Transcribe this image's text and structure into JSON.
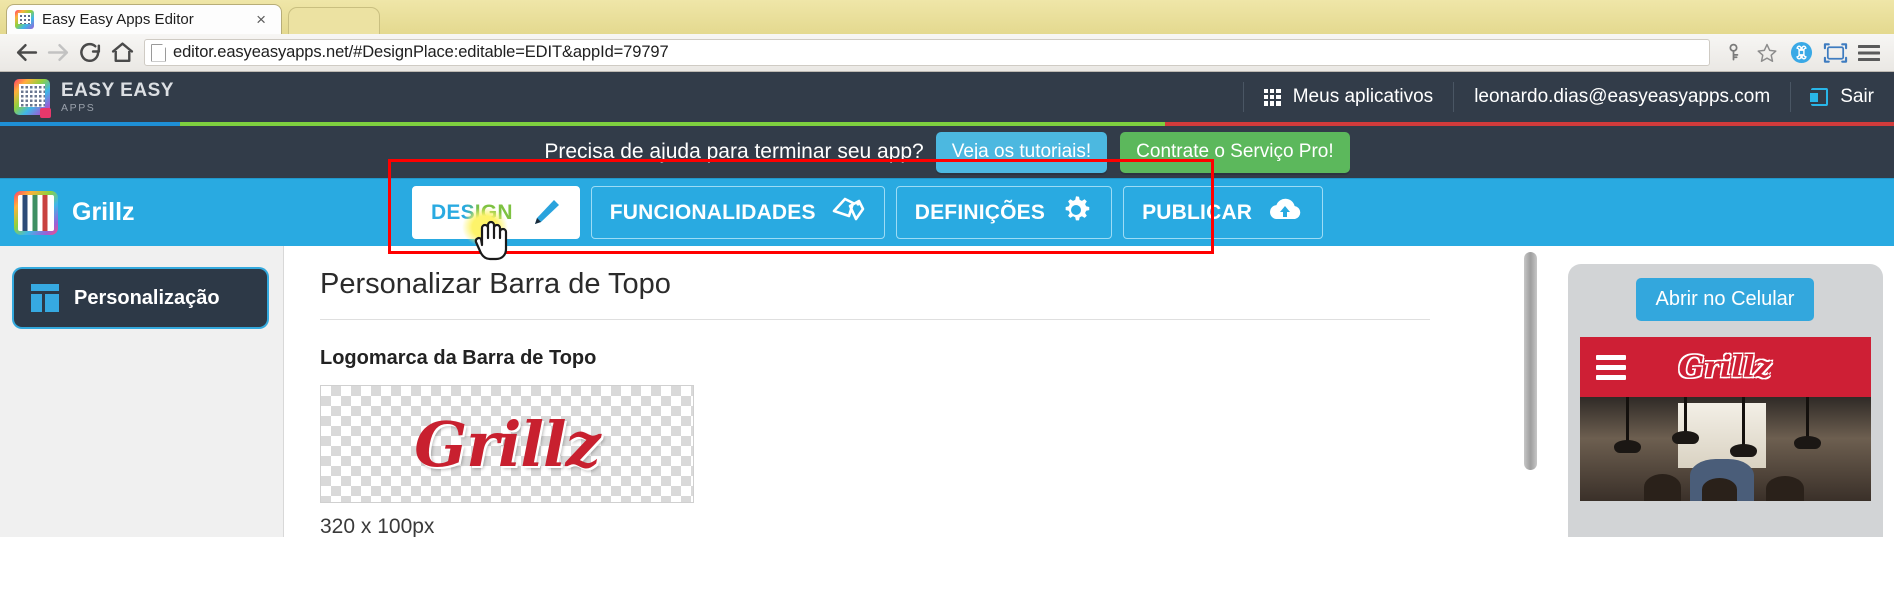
{
  "browser": {
    "tab": {
      "title": "Easy Easy Apps Editor",
      "close_label": "×",
      "favicon": "easyapps-favicon"
    },
    "back_icon": "back-arrow-icon",
    "forward_icon": "forward-arrow-icon",
    "reload_icon": "reload-icon",
    "home_icon": "home-icon",
    "url": {
      "full": "editor.easyeasyapps.net/#DesignPlace:editable=EDIT&appId=79797",
      "host": "editor.easyeasyapps.net",
      "path": "/#DesignPlace:editable=EDIT&appId=79797"
    },
    "tools": [
      "key-icon",
      "star-icon",
      "command-badge-icon",
      "fullscreen-icon",
      "menu-icon"
    ]
  },
  "app_header": {
    "brand_line1": "EASY EASY",
    "brand_line2": "APPS",
    "apps_link": "Meus aplicativos",
    "user_email": "leonardo.dias@easyeasyapps.com",
    "logout": "Sair"
  },
  "help_bar": {
    "text": "Precisa de ajuda para terminar seu app?",
    "tutorials_button": "Veja os tutoriais!",
    "pro_button": "Contrate o Serviço Pro!",
    "colors": {
      "tutorials": "#4cb8e0",
      "pro": "#5cb85c"
    }
  },
  "app_nav": {
    "app_name": "Grillz",
    "tabs": [
      {
        "label": "DESIGN",
        "icon": "paintbrush-icon",
        "active": true
      },
      {
        "label": "FUNCIONALIDADES",
        "icon": "tags-icon",
        "active": false
      },
      {
        "label": "DEFINIÇÕES",
        "icon": "gear-icon",
        "active": false
      },
      {
        "label": "PUBLICAR",
        "icon": "cloud-upload-icon",
        "active": false
      }
    ],
    "background": "#29aae1"
  },
  "sidebar": {
    "items": [
      {
        "label": "Personalização",
        "icon": "layout-icon",
        "selected": true
      }
    ]
  },
  "content": {
    "title": "Personalizar Barra de Topo",
    "section_label": "Logomarca da Barra de Topo",
    "logo_text": "Grillz",
    "dimensions": "320 x 100px"
  },
  "preview": {
    "open_button": "Abrir no Celular",
    "menu_icon": "hamburger-icon",
    "app_logo": "Grillz"
  },
  "annotation": {
    "color": "#ff0000",
    "shape": "rectangle"
  }
}
